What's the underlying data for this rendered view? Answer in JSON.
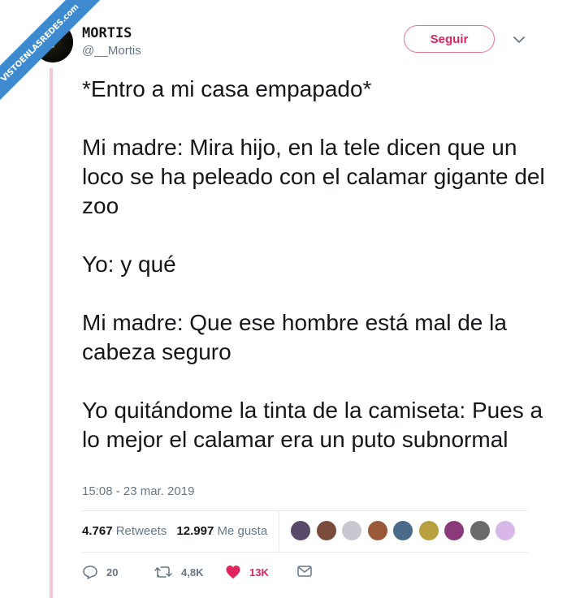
{
  "watermark": "VISTOENLASREDES.com",
  "author": {
    "name": "MORTIS",
    "handle": "@__Mortis"
  },
  "follow_label": "Seguir",
  "tweet": {
    "text": "*Entro a mi casa empapado*\n\nMi madre: Mira hijo, en la tele dicen que un loco se ha peleado con el calamar gigante del zoo\n\nYo: y qué\n\nMi madre: Que ese hombre está mal de la cabeza seguro\n\nYo quitándome la tinta de la camiseta: Pues a lo mejor el calamar era un puto subnormal",
    "timestamp": "15:08 - 23 mar. 2019"
  },
  "stats": {
    "retweets_count": "4.767",
    "retweets_label": "Retweets",
    "likes_count": "12.997",
    "likes_label": "Me gusta"
  },
  "liker_colors": [
    "#5a4a6a",
    "#7a4a3a",
    "#c8c8d0",
    "#9a5a3a",
    "#4a6a8a",
    "#b8a040",
    "#8a3a7a",
    "#6a6a6a",
    "#d8b8e8"
  ],
  "actions": {
    "replies": "20",
    "retweets": "4,8K",
    "likes": "13K"
  },
  "colors": {
    "like_red": "#e0245e",
    "watermark_blue": "#3d8ad0"
  }
}
